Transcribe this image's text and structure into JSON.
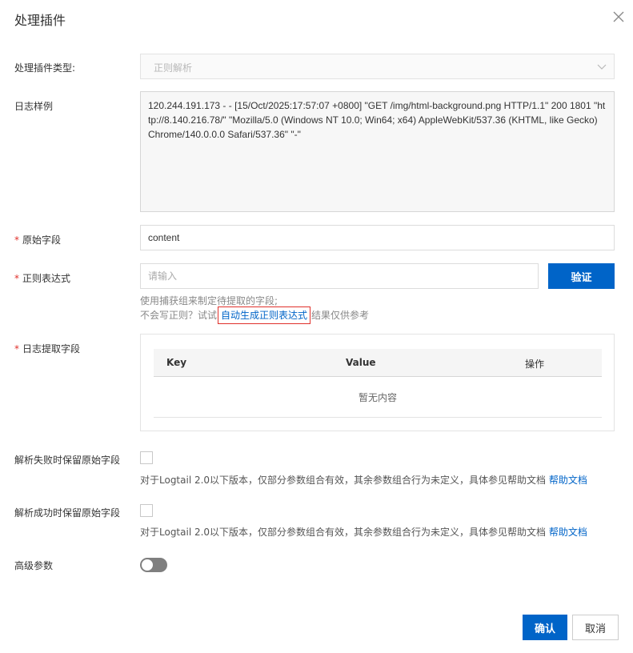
{
  "dialog": {
    "title": "处理插件"
  },
  "form": {
    "plugin_type": {
      "label": "处理插件类型:",
      "value": "正则解析"
    },
    "log_sample": {
      "label": "日志样例",
      "value": "120.244.191.173 - - [15/Oct/2025:17:57:07 +0800] \"GET /img/html-background.png HTTP/1.1\" 200 1801 \"http://8.140.216.78/\" \"Mozilla/5.0 (Windows NT 10.0; Win64; x64) AppleWebKit/537.36 (KHTML, like Gecko) Chrome/140.0.0.0 Safari/537.36\" \"-\""
    },
    "original_field": {
      "required_mark": "*",
      "label": "原始字段",
      "value": "content"
    },
    "regex": {
      "required_mark": "*",
      "label": "正则表达式",
      "placeholder": "请输入",
      "validate_label": "验证",
      "hint_line1": "使用捕获组来制定待提取的字段;",
      "hint_line2_prefix": "不会写正则？试试",
      "auto_generate_link": "自动生成正则表达式",
      "hint_line2_suffix": "结果仅供参考"
    },
    "extract_fields": {
      "required_mark": "*",
      "label": "日志提取字段",
      "columns": [
        "Key",
        "Value",
        "操作"
      ],
      "empty_text": "暂无内容"
    },
    "keep_on_fail": {
      "label": "解析失败时保留原始字段",
      "checked": false,
      "hint": "对于Logtail 2.0以下版本，仅部分参数组合有效，其余参数组合行为未定义，具体参见帮助文档",
      "help_link": "帮助文档"
    },
    "keep_on_success": {
      "label": "解析成功时保留原始字段",
      "checked": false,
      "hint": "对于Logtail 2.0以下版本，仅部分参数组合有效，其余参数组合行为未定义，具体参见帮助文档",
      "help_link": "帮助文档"
    },
    "advanced": {
      "label": "高级参数",
      "enabled": false
    }
  },
  "footer": {
    "confirm_label": "确认",
    "cancel_label": "取消"
  },
  "colors": {
    "primary": "#0064c8",
    "required": "#e0312b",
    "highlight_box": "#e0312b",
    "toggle_off": "#7f7f7f"
  }
}
